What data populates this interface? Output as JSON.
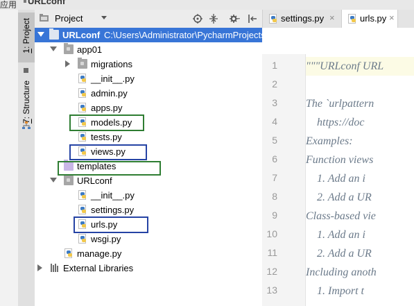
{
  "window": {
    "cjk_fragment": "应用",
    "project_name": "URLconf"
  },
  "toolwindow_stripe": {
    "project_tab": {
      "number": "1",
      "label": ": Project"
    },
    "structure_tab": {
      "number": "7",
      "label": ": Structure"
    }
  },
  "project_panel": {
    "title": "Project",
    "tools": [
      "crosshair-icon",
      "collapse-all-icon",
      "settings-gear-icon",
      "hide-panel-icon"
    ],
    "tree": [
      {
        "label": "URLconf",
        "path": "C:\\Users\\Administrator\\PycharmProjects\\",
        "type": "root-folder",
        "expanded": true,
        "selected": true
      },
      {
        "label": "app01",
        "type": "package",
        "expanded": true
      },
      {
        "label": "migrations",
        "type": "package",
        "expanded": false
      },
      {
        "label": "__init__.py",
        "type": "python-file"
      },
      {
        "label": "admin.py",
        "type": "python-file"
      },
      {
        "label": "apps.py",
        "type": "python-file"
      },
      {
        "label": "models.py",
        "type": "python-file",
        "highlight": "green"
      },
      {
        "label": "tests.py",
        "type": "python-file"
      },
      {
        "label": "views.py",
        "type": "python-file",
        "highlight": "blue"
      },
      {
        "label": "templates",
        "type": "template-folder",
        "highlight": "green"
      },
      {
        "label": "URLconf",
        "type": "package",
        "expanded": true
      },
      {
        "label": "__init__.py",
        "type": "python-file"
      },
      {
        "label": "settings.py",
        "type": "python-file"
      },
      {
        "label": "urls.py",
        "type": "python-file",
        "highlight": "blue"
      },
      {
        "label": "wsgi.py",
        "type": "python-file"
      },
      {
        "label": "manage.py",
        "type": "python-file"
      },
      {
        "label": "External Libraries",
        "type": "libraries",
        "expanded": false
      }
    ]
  },
  "editor": {
    "tabs": [
      {
        "label": "settings.py",
        "close": "×",
        "active": false
      },
      {
        "label": "urls.py",
        "close": "×",
        "active": true
      }
    ],
    "line_numbers": [
      "1",
      "2",
      "3",
      "4",
      "5",
      "6",
      "7",
      "8",
      "9",
      "10",
      "11",
      "12",
      "13"
    ],
    "code_lines": [
      "\"\"\"URLconf URL",
      "",
      "The `urlpattern",
      "    https://doc",
      "Examples:",
      "Function views",
      "    1. Add an i",
      "    2. Add a UR",
      "Class-based vie",
      "    1. Add an i",
      "    2. Add a UR",
      "Including anoth",
      "    1. Import t"
    ]
  },
  "colors": {
    "selection": "#3875d7",
    "green_box": "#2e7d32",
    "blue_box": "#2543a4",
    "docstring": "#6b7a8a",
    "current_line": "#fcfbe5"
  }
}
